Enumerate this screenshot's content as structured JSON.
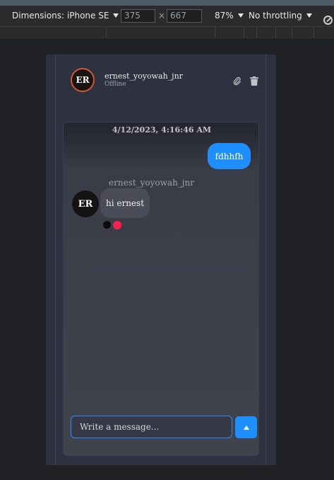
{
  "devtools": {
    "dimensions_label": "Dimensions: iPhone SE",
    "width": "375",
    "times": "×",
    "height": "667",
    "zoom": "87%",
    "throttling": "No throttling"
  },
  "chat": {
    "contact": {
      "initials": "ER",
      "name": "ernest_yoyowah_jnr",
      "status": "Offline"
    },
    "date": "4/12/2023, 4:16:46 AM",
    "outgoing_message": "fdhhfh",
    "incoming": {
      "sender": "ernest_yoyowah_jnr",
      "initials": "ER",
      "message": "hi ernest"
    },
    "reaction_colors": [
      "#0c0c0c",
      "#ff1f4b"
    ],
    "input_placeholder": "Write a message..."
  },
  "icons": {
    "attach": "paperclip-icon",
    "delete": "trash-icon",
    "send": "triangle-up-icon",
    "rotate": "rotate-icon"
  }
}
